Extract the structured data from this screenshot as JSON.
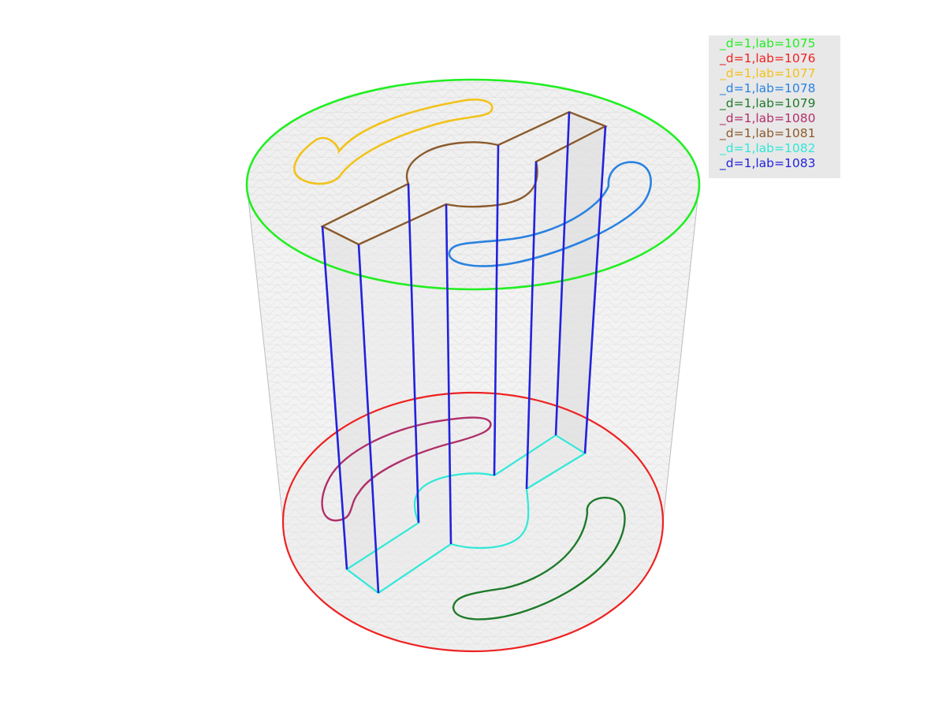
{
  "legend": {
    "items": [
      {
        "label": "_d=1,lab=1075",
        "color": "#22ee22"
      },
      {
        "label": "_d=1,lab=1076",
        "color": "#ee2222"
      },
      {
        "label": "_d=1,lab=1077",
        "color": "#f2c21a"
      },
      {
        "label": "_d=1,lab=1078",
        "color": "#2a82e0"
      },
      {
        "label": "_d=1,lab=1079",
        "color": "#1e7a2a"
      },
      {
        "label": "_d=1,lab=1080",
        "color": "#b0306a"
      },
      {
        "label": "_d=1,lab=1081",
        "color": "#8b5a2b"
      },
      {
        "label": "_d=1,lab=1082",
        "color": "#30e8d8"
      },
      {
        "label": "_d=1,lab=1083",
        "color": "#2222dd"
      }
    ]
  },
  "mesh": {
    "surface_color": "#f2f2f2",
    "wire_color": "#cfcfcf"
  }
}
